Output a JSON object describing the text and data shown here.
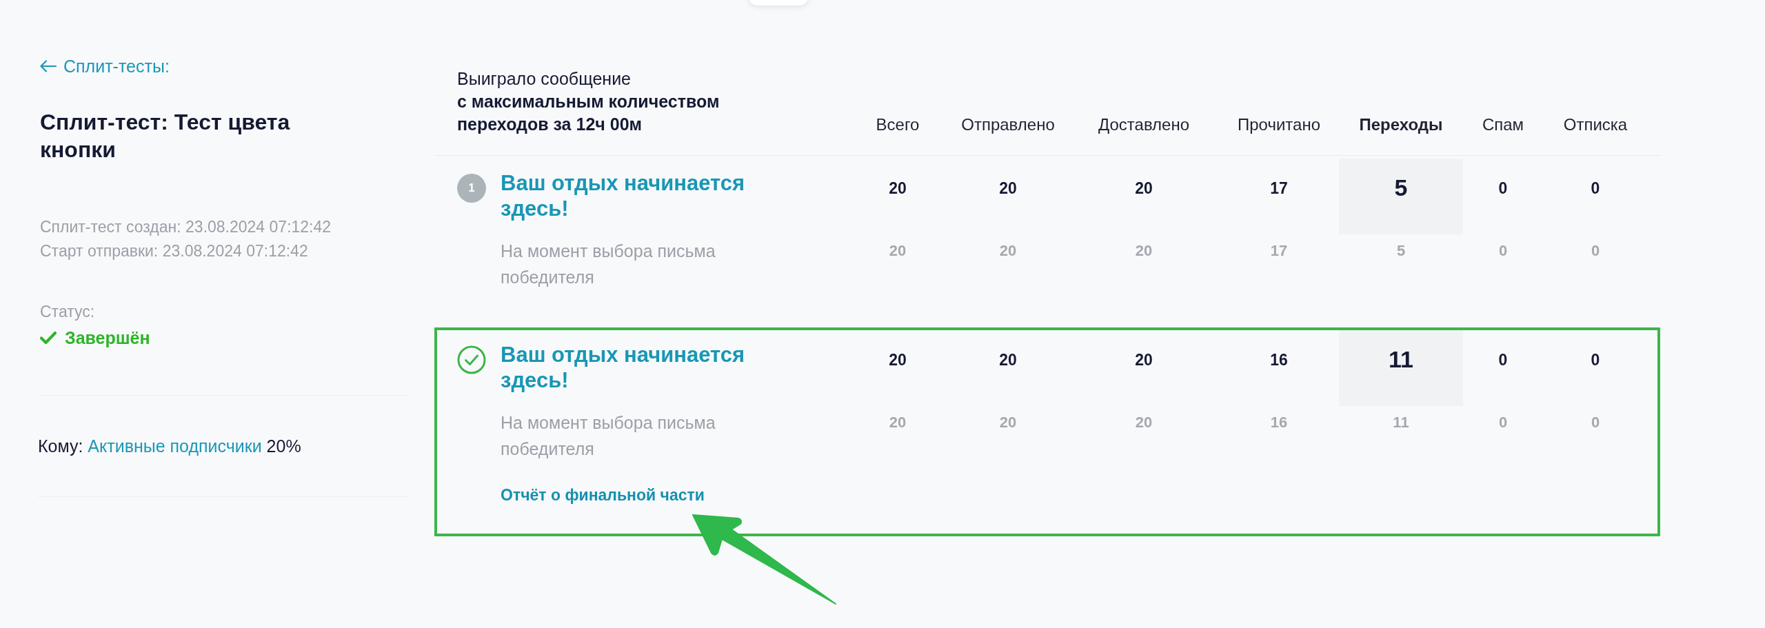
{
  "back_link": {
    "label": "Сплит-тесты:"
  },
  "title": "Сплит-тест: Тест цвета кнопки",
  "meta": [
    "Сплит-тест создан: 23.08.2024 07:12:42",
    "Старт отправки: 23.08.2024 07:12:42"
  ],
  "status": {
    "label": "Статус:",
    "value": "Завершён",
    "kind": "completed"
  },
  "recipients": {
    "label": "Кому:",
    "segment": "Активные подписчики",
    "share": "20%"
  },
  "table": {
    "caption": "Выиграло сообщение",
    "criterion": "с максимальным количеством переходов за 12ч 00м",
    "columns": [
      {
        "label": "Всего",
        "selected": false
      },
      {
        "label": "Отправлено",
        "selected": false
      },
      {
        "label": "Доставлено",
        "selected": false
      },
      {
        "label": "Прочитано",
        "selected": false
      },
      {
        "label": "Переходы",
        "selected": true
      },
      {
        "label": "Спам",
        "selected": false
      },
      {
        "label": "Отписка",
        "selected": false
      }
    ],
    "rows": [
      {
        "winner": false,
        "badge": "1",
        "framed": false,
        "subject": "Ваш отдых начинается здесь!",
        "values": [
          "20",
          "20",
          "20",
          "17",
          "5",
          "0",
          "0"
        ],
        "snapshot_label": "На момент выбора письма победителя",
        "snapshot_values": [
          "20",
          "20",
          "20",
          "17",
          "5",
          "0",
          "0"
        ]
      },
      {
        "winner": true,
        "framed": true,
        "subject": "Ваш отдых начинается здесь!",
        "values": [
          "20",
          "20",
          "20",
          "16",
          "11",
          "0",
          "0"
        ],
        "snapshot_label": "На момент выбора письма победителя",
        "snapshot_values": [
          "20",
          "20",
          "20",
          "16",
          "11",
          "0",
          "0"
        ],
        "report_link": "Отчёт о финальной части"
      }
    ]
  },
  "annotation_arrow": true
}
